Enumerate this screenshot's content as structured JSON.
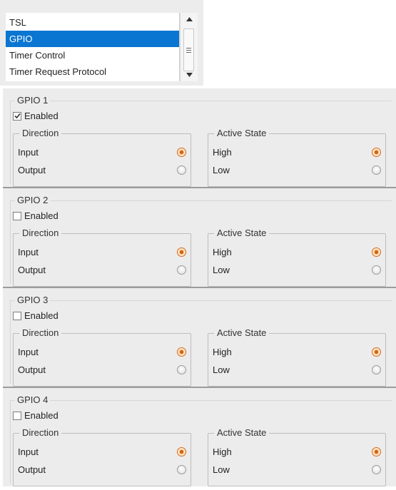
{
  "list": {
    "items": [
      "TSL",
      "GPIO",
      "Timer Control",
      "Timer Request Protocol"
    ],
    "selected_index": 1
  },
  "labels": {
    "enabled": "Enabled",
    "direction": "Direction",
    "input": "Input",
    "output": "Output",
    "active_state": "Active State",
    "high": "High",
    "low": "Low"
  },
  "gpios": [
    {
      "title": "GPIO 1",
      "enabled": true,
      "direction": "Input",
      "active_state": "High"
    },
    {
      "title": "GPIO 2",
      "enabled": false,
      "direction": "Input",
      "active_state": "High"
    },
    {
      "title": "GPIO 3",
      "enabled": false,
      "direction": "Input",
      "active_state": "High"
    },
    {
      "title": "GPIO 4",
      "enabled": false,
      "direction": "Input",
      "active_state": "High"
    }
  ],
  "colors": {
    "selection": "#0a76d2",
    "radio_selected": "#d0661a"
  }
}
